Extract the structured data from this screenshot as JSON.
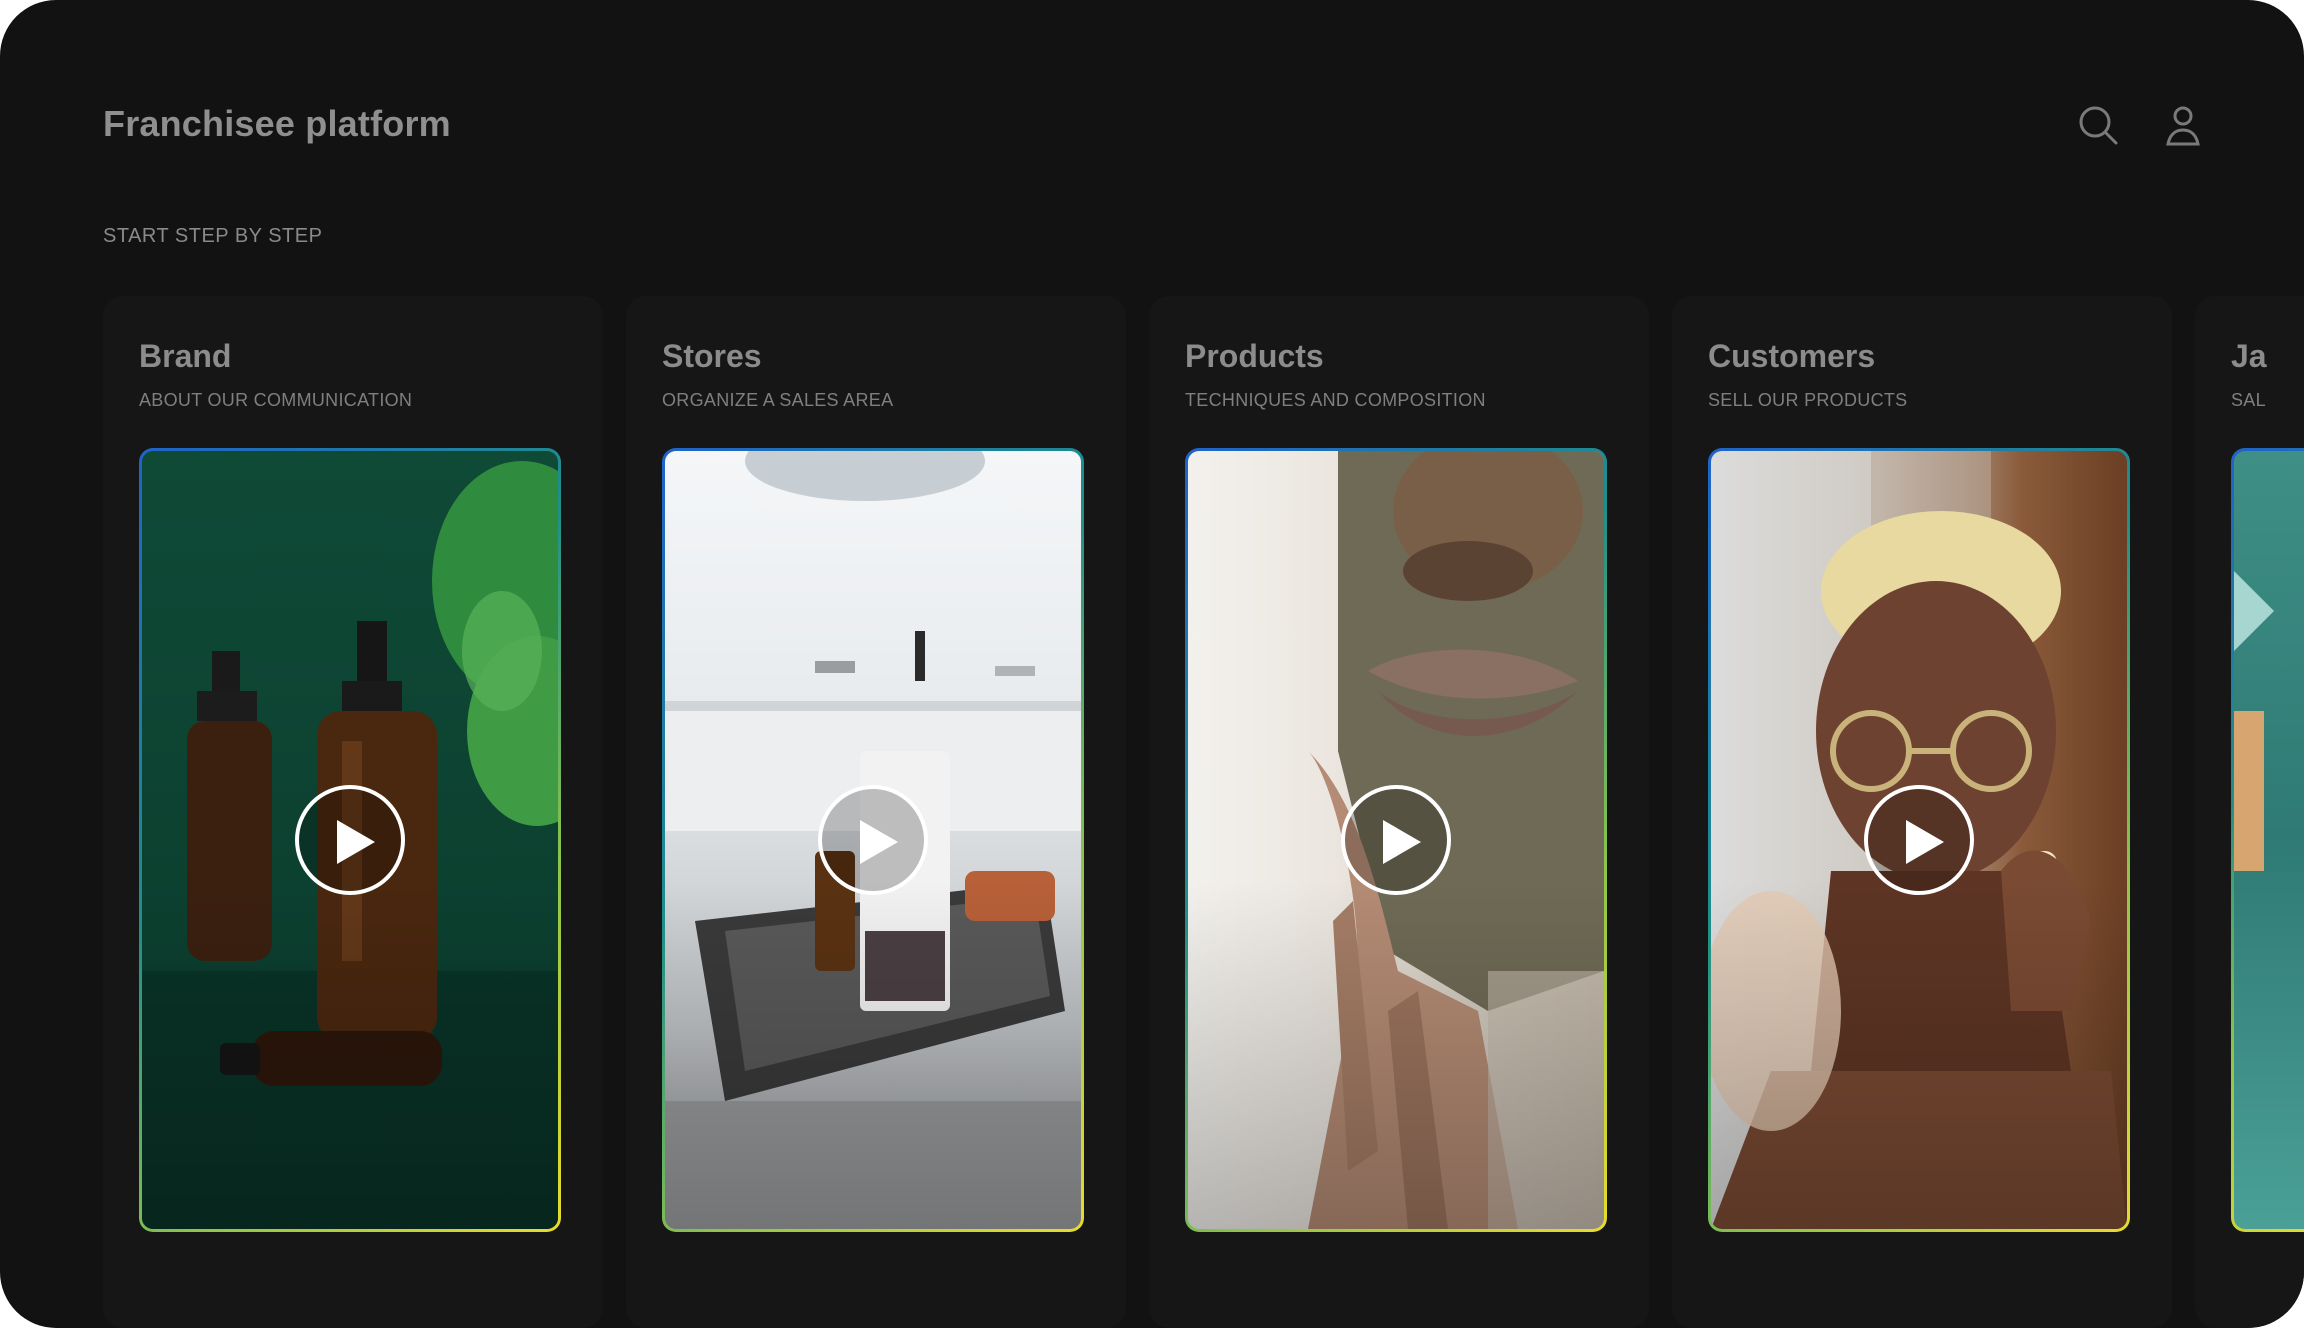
{
  "header": {
    "title": "Franchisee platform",
    "icons": [
      "search-icon",
      "user-icon"
    ]
  },
  "section_label": "START STEP BY STEP",
  "cards": [
    {
      "title": "Brand",
      "subtitle": "ABOUT OUR COMMUNICATION",
      "image": "amber bottles with green leaf"
    },
    {
      "title": "Stores",
      "subtitle": "ORGANIZE A SALES AREA",
      "image": "marble tray with cosmetics"
    },
    {
      "title": "Products",
      "subtitle": "TECHNIQUES AND COMPOSITION",
      "image": "face with clay mask"
    },
    {
      "title": "Customers",
      "subtitle": "SELL OUR PRODUCTS",
      "image": "man applying lip balm"
    },
    {
      "title": "Ja",
      "subtitle": "SAL",
      "image": "partially visible card"
    }
  ],
  "colors": {
    "background": "#121212",
    "card": "#161616",
    "text": "#8c8c8c",
    "border_start": "#1f63c9",
    "border_end": "#e8dc2c"
  }
}
